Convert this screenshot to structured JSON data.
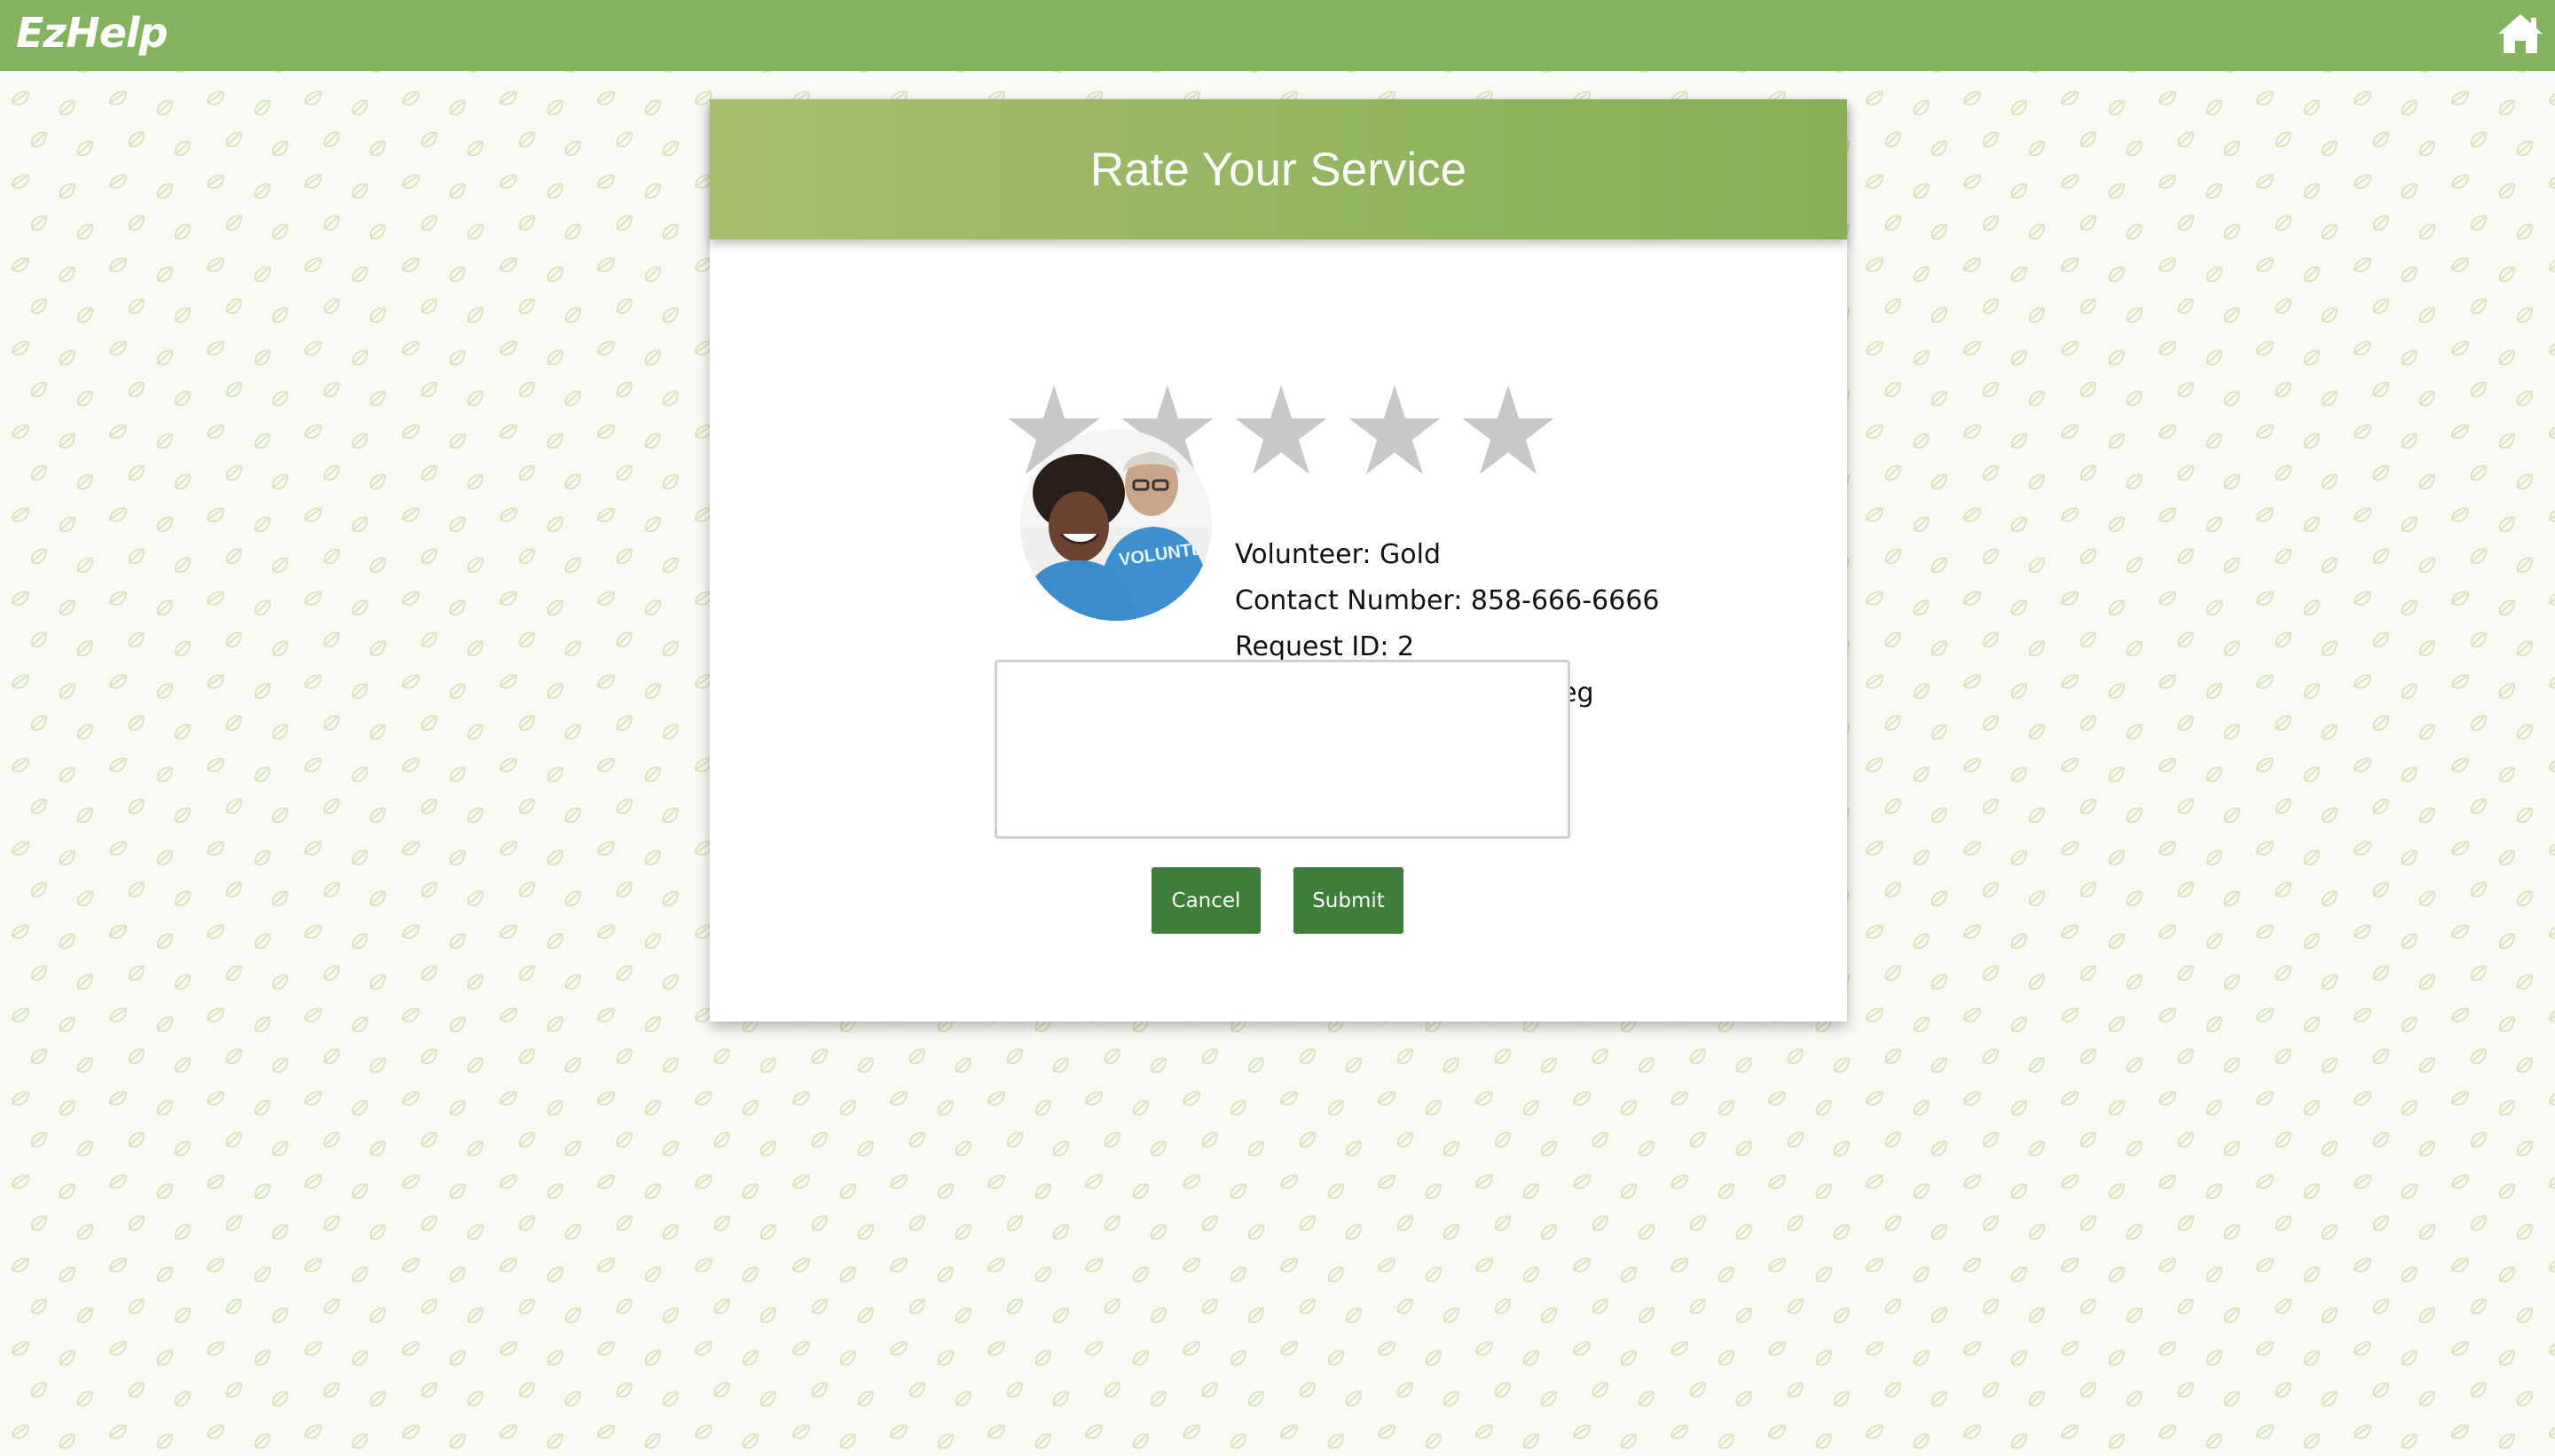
{
  "app": {
    "logo_text": "EzHelp",
    "home_icon": "home-icon"
  },
  "card": {
    "title": "Rate Your Service",
    "rating": {
      "value": 0,
      "max": 5,
      "star_icon": "star-icon"
    },
    "avatar_icon": "volunteer-photo",
    "volunteer_line": "Volunteer: Gold",
    "contact_line": "Contact Number: 858-666-6666",
    "request_line": "Request ID: 2",
    "description_line": "Description: I broke my leg",
    "feedback": {
      "value": "",
      "placeholder": ""
    },
    "cancel_label": "Cancel",
    "submit_label": "Submit"
  },
  "colors": {
    "topbar": "#84b35f",
    "button": "#3f7e3a",
    "star_empty": "#c8c8c8",
    "background": "#f9faf4",
    "leaf": "#d6e4b8"
  }
}
